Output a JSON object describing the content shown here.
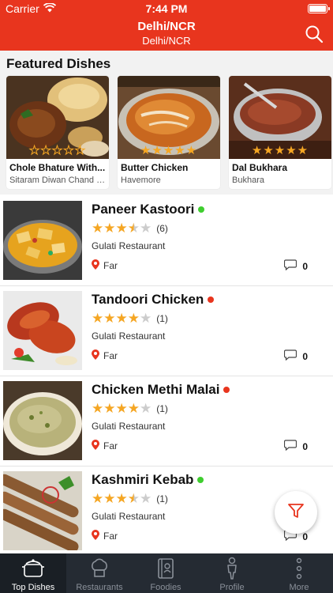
{
  "status_bar": {
    "carrier": "Carrier",
    "time": "7:44 PM"
  },
  "header": {
    "title": "Delhi/NCR",
    "subtitle": "Delhi/NCR",
    "search_icon": "search-icon"
  },
  "featured": {
    "title": "Featured Dishes",
    "cards": [
      {
        "name": "Chole Bhature With...",
        "restaurant": "Sitaram Diwan Chand C...",
        "rating": 0,
        "rating_max": 5
      },
      {
        "name": "Butter Chicken",
        "restaurant": "Havemore",
        "rating": 5,
        "rating_max": 5
      },
      {
        "name": "Dal Bukhara",
        "restaurant": "Bukhara",
        "rating": 5,
        "rating_max": 5
      }
    ]
  },
  "dishes": [
    {
      "name": "Paneer Kastoori",
      "status_color": "#3fce2f",
      "rating": 3.5,
      "rating_max": 5,
      "count": "(6)",
      "restaurant": "Gulati Restaurant",
      "distance": "Far",
      "comments": "0"
    },
    {
      "name": "Tandoori Chicken",
      "status_color": "#e8351e",
      "rating": 4,
      "rating_max": 5,
      "count": "(1)",
      "restaurant": "Gulati Restaurant",
      "distance": "Far",
      "comments": "0"
    },
    {
      "name": "Chicken Methi Malai",
      "status_color": "#e8351e",
      "rating": 4,
      "rating_max": 5,
      "count": "(1)",
      "restaurant": "Gulati Restaurant",
      "distance": "Far",
      "comments": "0"
    },
    {
      "name": "Kashmiri Kebab",
      "status_color": "#3fce2f",
      "rating": 3.5,
      "rating_max": 5,
      "count": "(1)",
      "restaurant": "Gulati Restaurant",
      "distance": "Far",
      "comments": "0"
    }
  ],
  "tabs": [
    {
      "label": "Top Dishes",
      "icon": "pot-icon",
      "active": true
    },
    {
      "label": "Restaurants",
      "icon": "chef-hat-icon",
      "active": false
    },
    {
      "label": "Foodies",
      "icon": "book-icon",
      "active": false
    },
    {
      "label": "Profile",
      "icon": "person-icon",
      "active": false
    },
    {
      "label": "More",
      "icon": "more-dots-icon",
      "active": false
    }
  ],
  "colors": {
    "brand": "#e8351e",
    "star": "#f5a623",
    "star_empty": "#cccccc",
    "tabbar": "#252b33"
  }
}
